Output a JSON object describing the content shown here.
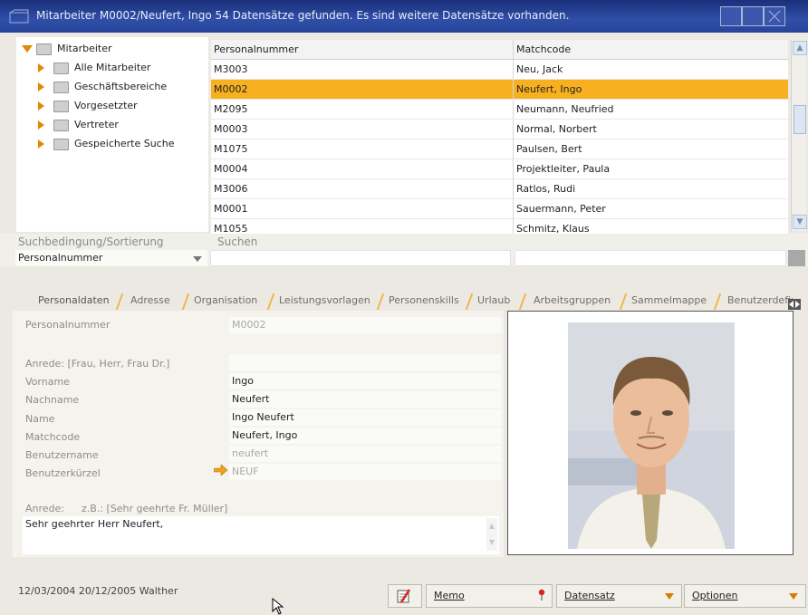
{
  "window": {
    "title": "Mitarbeiter M0002/Neufert, Ingo   54 Datensätze gefunden. Es sind weitere Datensätze vorhanden."
  },
  "tree": {
    "root": "Mitarbeiter",
    "items": [
      "Alle Mitarbeiter",
      "Geschäftsbereiche",
      "Vorgesetzter",
      "Vertreter",
      "Gespeicherte Suche"
    ]
  },
  "grid": {
    "columns": [
      "Personalnummer",
      "Matchcode"
    ],
    "selected_index": 1,
    "rows": [
      [
        "M3003",
        "Neu, Jack"
      ],
      [
        "M0002",
        "Neufert, Ingo"
      ],
      [
        "M2095",
        "Neumann, Neufried"
      ],
      [
        "M0003",
        "Normal, Norbert"
      ],
      [
        "M1075",
        "Paulsen, Bert"
      ],
      [
        "M0004",
        "Projektleiter, Paula"
      ],
      [
        "M3006",
        "Ratlos, Rudi"
      ],
      [
        "M0001",
        "Sauermann, Peter"
      ],
      [
        "M1055",
        "Schmitz, Klaus"
      ]
    ]
  },
  "search": {
    "condition_label": "Suchbedingung/Sortierung",
    "search_label": "Suchen",
    "condition_value": "Personalnummer",
    "search_value": ""
  },
  "tabs": [
    "Personaldaten",
    "Adresse",
    "Organisation",
    "Leistungsvorlagen",
    "Personenskills",
    "Urlaub",
    "Arbeitsgruppen",
    "Sammelmappe",
    "Benutzerdefin"
  ],
  "form": {
    "personalnummer_label": "Personalnummer",
    "personalnummer_value": "M0002",
    "anrede_label": "Anrede: [Frau, Herr, Frau Dr.]",
    "anrede_value": "",
    "vorname_label": "Vorname",
    "vorname_value": "Ingo",
    "nachname_label": "Nachname",
    "nachname_value": "Neufert",
    "name_label": "Name",
    "name_value": "Ingo Neufert",
    "matchcode_label": "Matchcode",
    "matchcode_value": "Neufert, Ingo",
    "benutzername_label": "Benutzername",
    "benutzername_value": "neufert",
    "benutzerkuerzel_label": "Benutzerkürzel",
    "benutzerkuerzel_value": "NEUF",
    "anrede_brief_label": "Anrede:",
    "anrede_brief_hint": "z.B.: [Sehr geehrte Fr. Müller]",
    "anrede_brief_value": "Sehr geehrter Herr Neufert,"
  },
  "status": {
    "info": "12/03/2004 20/12/2005 Walther"
  },
  "toolbar": {
    "memo_label": "Memo",
    "datensatz_label": "Datensatz",
    "optionen_label": "Optionen"
  },
  "colors": {
    "accent_orange": "#f7b120",
    "titlebar_blue": "#2f4fa8"
  }
}
